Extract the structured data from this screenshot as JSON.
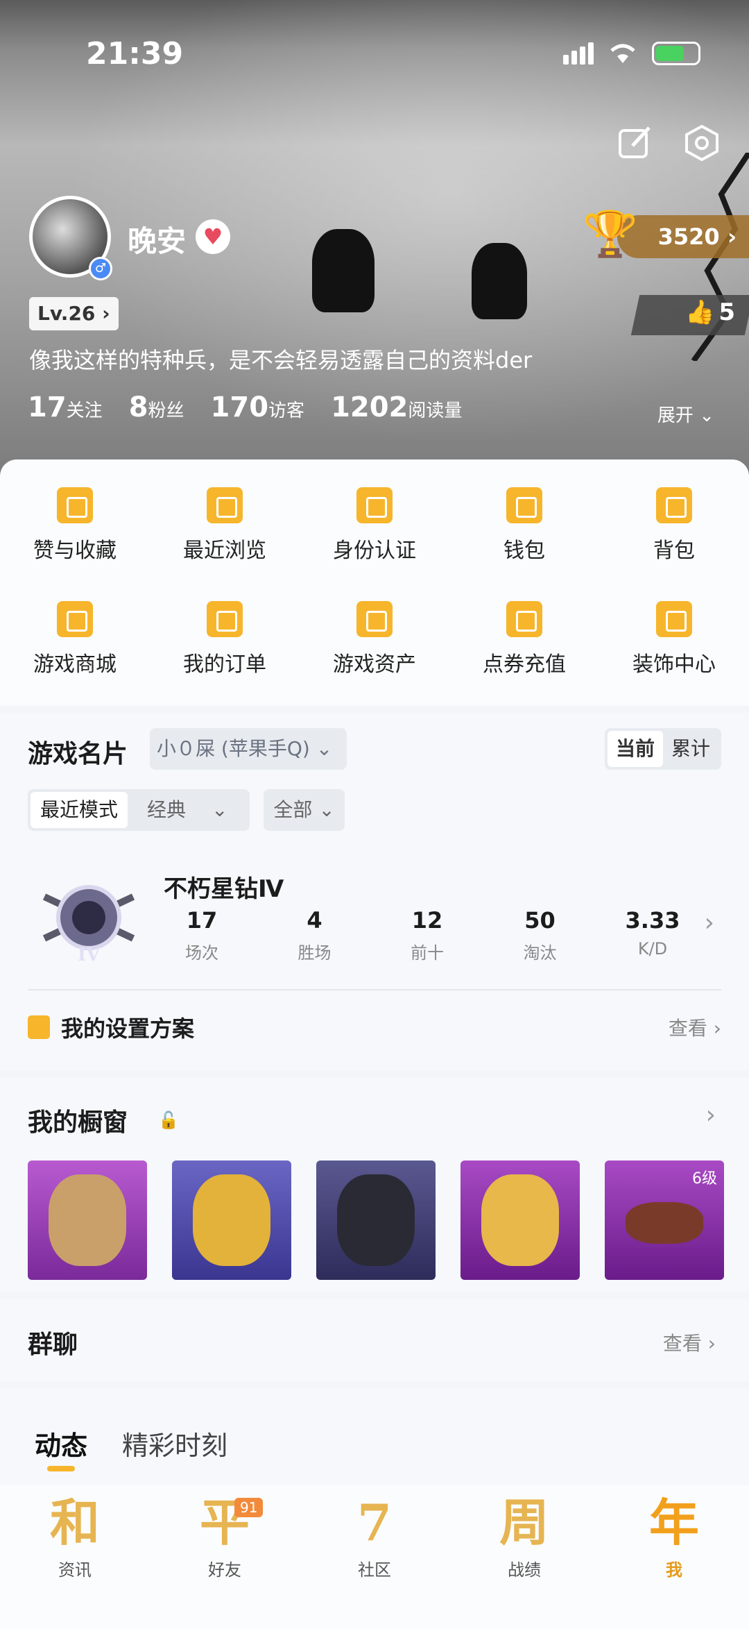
{
  "status": {
    "time": "21:39"
  },
  "profile": {
    "nickname": "晚安",
    "level": "Lv.26",
    "trophies": "3520",
    "likes": "5",
    "bio": "像我这样的特种兵，是不会轻易透露自己的资料der",
    "stats": [
      {
        "num": "17",
        "label": "关注"
      },
      {
        "num": "8",
        "label": "粉丝"
      },
      {
        "num": "170",
        "label": "访客"
      },
      {
        "num": "1202",
        "label": "阅读量"
      }
    ],
    "expand": "展开"
  },
  "grid_items": [
    {
      "label": "赞与收藏"
    },
    {
      "label": "最近浏览"
    },
    {
      "label": "身份认证"
    },
    {
      "label": "钱包"
    },
    {
      "label": "背包"
    },
    {
      "label": "游戏商城"
    },
    {
      "label": "我的订单"
    },
    {
      "label": "游戏资产"
    },
    {
      "label": "点券充值"
    },
    {
      "label": "装饰中心"
    }
  ],
  "game_card": {
    "title": "游戏名片",
    "account": "小０屎 (苹果手Q)",
    "seg_current": "当前",
    "seg_total": "累计",
    "mode_recent": "最近模式",
    "mode_classic": "经典",
    "mode_all": "全部",
    "rank_name": "不朽星钻Ⅳ",
    "rank_tier": "IV",
    "stats": [
      {
        "v": "17",
        "k": "场次"
      },
      {
        "v": "4",
        "k": "胜场"
      },
      {
        "v": "12",
        "k": "前十"
      },
      {
        "v": "50",
        "k": "淘汰"
      },
      {
        "v": "3.33",
        "k": "K/D"
      }
    ],
    "settings_label": "我的设置方案",
    "view": "查看"
  },
  "showcase": {
    "title": "我的橱窗",
    "items": [
      {
        "bg": "#9b3ab5",
        "color": "#c9a06a"
      },
      {
        "bg": "#4e4aa6",
        "color": "#e3b23a"
      },
      {
        "bg": "#3d3c70",
        "color": "#2a2a35"
      },
      {
        "bg": "#8a2ca8",
        "color": "#e8b84a"
      },
      {
        "bg": "#8a2ca8",
        "color": "#7a3a2a",
        "level": "6级"
      }
    ]
  },
  "group": {
    "title": "群聊",
    "view": "查看"
  },
  "tabs": {
    "tab1": "动态",
    "tab2": "精彩时刻"
  },
  "bottom_nav": [
    {
      "glyph": "和",
      "label": "资讯"
    },
    {
      "glyph": "平",
      "label": "好友",
      "badge": "91"
    },
    {
      "glyph": "7",
      "label": "社区"
    },
    {
      "glyph": "周",
      "label": "战绩"
    },
    {
      "glyph": "年",
      "label": "我"
    }
  ],
  "colors": {
    "accent": "#f7b52c",
    "active_tab": "#e69a1a"
  }
}
